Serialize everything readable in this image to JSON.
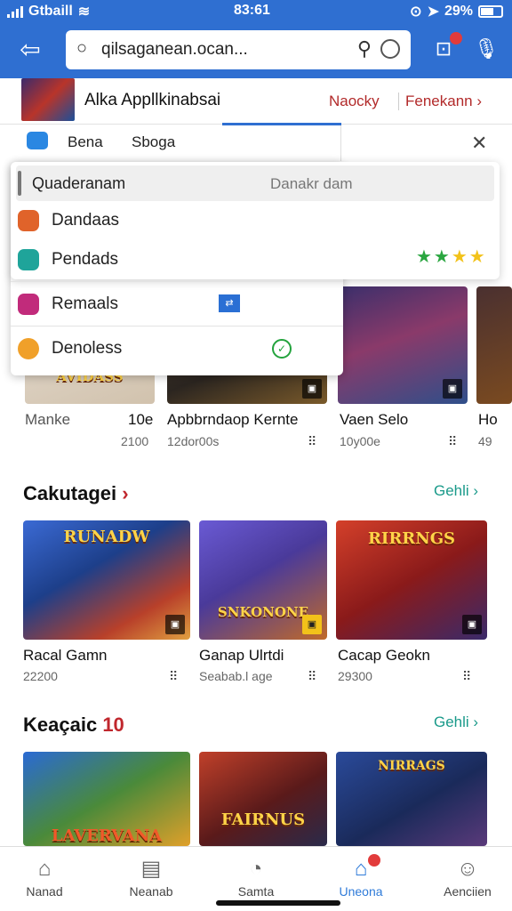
{
  "status": {
    "carrier": "Gtbaill",
    "time": "83:61",
    "battery": "29%"
  },
  "search": {
    "value": "qilsaganean.ocan..."
  },
  "app": {
    "title": "Alka Appllkinabsai",
    "link1": "Naocky",
    "link2": "Fenekann"
  },
  "popup": {
    "tab1": "Bena",
    "tab2": "Sboga",
    "head_left": "Quaderanam",
    "head_right": "Danakr dam",
    "items": [
      "Dandaas",
      "Pendads",
      "Remaals",
      "Denoless"
    ],
    "colors": {
      "dandaas": "#e0632a",
      "pendads": "#1fa49a",
      "remaals": "#c12b7b",
      "denoless": "#f0a02a"
    }
  },
  "top_row": [
    {
      "name": "Manke",
      "sub": "",
      "banner": "AVIDASS",
      "side": "10e",
      "side_sub": "2100"
    },
    {
      "name": "Apbbrndaop Kernte",
      "sub": "12dor00s"
    },
    {
      "name": "Vaen Selo",
      "sub": "10y00e"
    },
    {
      "name": "Ho",
      "sub": "49"
    }
  ],
  "section1": {
    "title": "Cakutagei",
    "more": "Gehli",
    "games": [
      {
        "name": "Racal Gamn",
        "sub": "22200",
        "banner": "RUNADW"
      },
      {
        "name": "Ganap Ulrtdi",
        "sub": "Seabab.l age",
        "banner": "SNKONONE"
      },
      {
        "name": "Cacap Geokn",
        "sub": "29300",
        "banner": "RIRRNGS"
      }
    ]
  },
  "section2": {
    "title": "Keaçaic",
    "title_num": "10",
    "more": "Gehli",
    "games": [
      {
        "banner": "LAVERVANA"
      },
      {
        "banner": "FAIRNUS"
      },
      {
        "banner": "NIRRAGS"
      }
    ]
  },
  "nav": [
    "Nanad",
    "Neanab",
    "Samta",
    "Uneona",
    "Aenciien"
  ]
}
